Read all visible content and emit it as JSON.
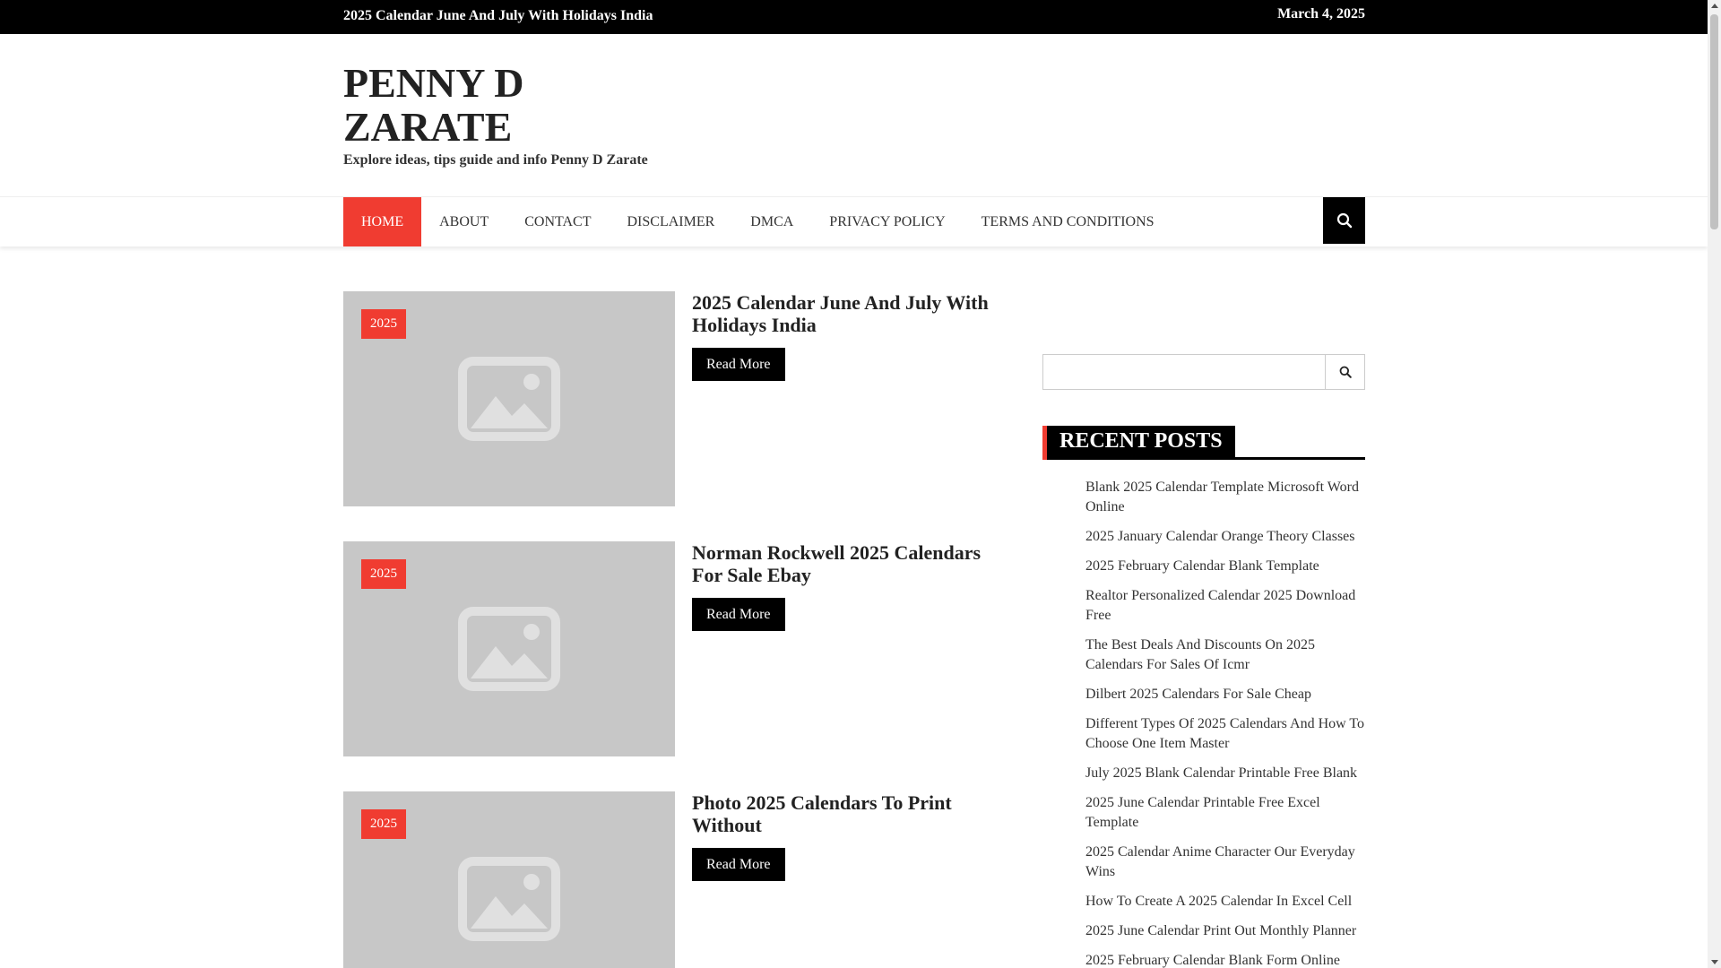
{
  "topbar": {
    "ticker": "2025 Calendar June And July With Holidays India",
    "date": "March 4, 2025"
  },
  "site": {
    "title": "PENNY D ZARATE",
    "tagline": "Explore ideas, tips guide and info Penny D Zarate"
  },
  "nav": {
    "items": [
      {
        "label": "HOME",
        "active": true
      },
      {
        "label": "ABOUT"
      },
      {
        "label": "CONTACT"
      },
      {
        "label": "DISCLAIMER"
      },
      {
        "label": "DMCA"
      },
      {
        "label": "PRIVACY POLICY"
      },
      {
        "label": "TERMS AND CONDITIONS"
      }
    ],
    "search_icon": "search-icon"
  },
  "posts": [
    {
      "category": "2025",
      "title": "2025 Calendar June And July With Holidays India",
      "read_more": "Read More"
    },
    {
      "category": "2025",
      "title": "Norman Rockwell 2025 Calendars For Sale Ebay",
      "read_more": "Read More"
    },
    {
      "category": "2025",
      "title": "Photo 2025 Calendars To Print Without",
      "read_more": "Read More"
    }
  ],
  "sidebar": {
    "search_placeholder": "",
    "recent_heading": "RECENT POSTS",
    "recent_posts": [
      "Blank 2025 Calendar Template Microsoft Word Online",
      "2025 January Calendar Orange Theory Classes",
      "2025 February Calendar Blank Template",
      "Realtor Personalized Calendar 2025 Download Free",
      "The Best Deals And Discounts On 2025 Calendars For Sales Of Icmr",
      "Dilbert 2025 Calendars For Sale Cheap",
      "Different Types Of 2025 Calendars And How To Choose One Item Master",
      "July 2025 Blank Calendar Printable Free Blank",
      "2025 June Calendar Printable Free Excel Template",
      "2025 Calendar Anime Character Our Everyday Wins",
      "How To Create A 2025 Calendar In Excel Cell",
      "2025 June Calendar Print Out Monthly Planner",
      "2025 February Calendar Blank Form Online"
    ]
  },
  "colors": {
    "accent": "#f03c31",
    "topbar": "#000000",
    "thumb_placeholder": "#c7c7c7"
  }
}
